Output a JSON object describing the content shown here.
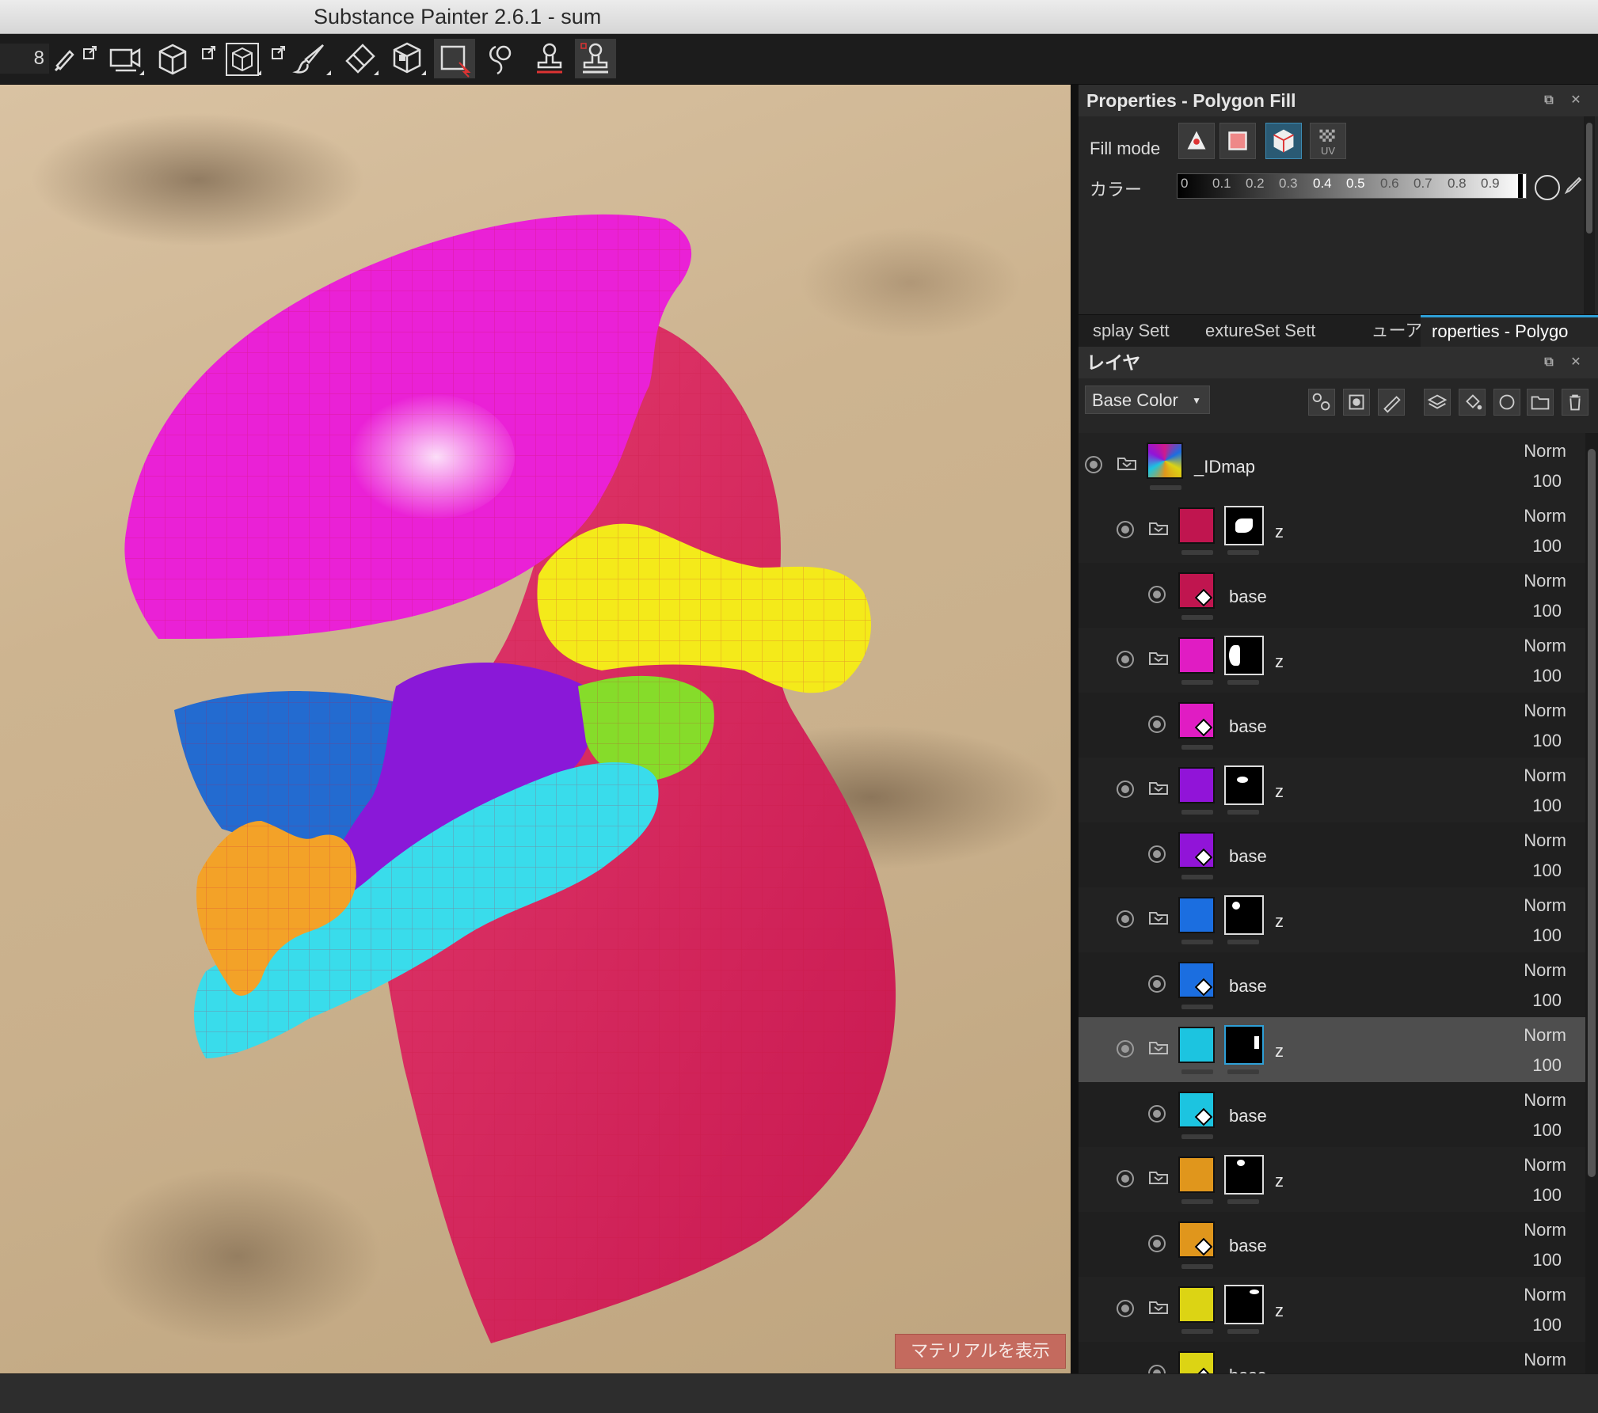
{
  "window": {
    "title": "Substance Painter 2.6.1 - sum"
  },
  "toolbar": {
    "brush_size": "8",
    "tools": [
      "brush-settings-icon",
      "camera-icon",
      "cube-icon",
      "cube-outline-icon",
      "paint-brush-icon",
      "eraser-icon",
      "projection-icon",
      "polygon-fill-icon",
      "smudge-icon",
      "clone-stamp-icon",
      "material-picker-icon"
    ]
  },
  "viewport": {
    "material_button": "マテリアルを表示"
  },
  "properties": {
    "title": "Properties - Polygon Fill",
    "fill_mode_label": "Fill mode",
    "fill_modes": [
      "triangle-fill-icon",
      "quad-fill-icon",
      "mesh-fill-icon",
      "uv-fill-icon"
    ],
    "fill_mode_selected": "mesh-fill-icon",
    "uv_label": "UV",
    "color_label": "カラー",
    "color_ticks": [
      "0",
      "0.1",
      "0.2",
      "0.3",
      "0.4",
      "0.5",
      "0.6",
      "0.7",
      "0.8",
      "0.9"
    ]
  },
  "tabs": [
    {
      "label": "splay Sett"
    },
    {
      "label": "extureSet Sett"
    },
    {
      "label": "ューア"
    },
    {
      "label": "roperties - Polygo",
      "active": true
    }
  ],
  "layers": {
    "title": "レイヤ",
    "channel": "Base Color",
    "rows": [
      {
        "kind": "group",
        "name": "_IDmap",
        "blend": "Norm",
        "opacity": "100",
        "depth": 0,
        "color": "#d01a8c",
        "mask": "none"
      },
      {
        "kind": "group",
        "name": "z",
        "blend": "Norm",
        "opacity": "100",
        "depth": 1,
        "color": "#c0154f",
        "mask": "shape-a"
      },
      {
        "kind": "fill",
        "name": "base",
        "blend": "Norm",
        "opacity": "100",
        "depth": 2,
        "color": "#c0154f"
      },
      {
        "kind": "group",
        "name": "z",
        "blend": "Norm",
        "opacity": "100",
        "depth": 1,
        "color": "#e01cc3",
        "mask": "shape-b"
      },
      {
        "kind": "fill",
        "name": "base",
        "blend": "Norm",
        "opacity": "100",
        "depth": 2,
        "color": "#e01cc3"
      },
      {
        "kind": "group",
        "name": "z",
        "blend": "Norm",
        "opacity": "100",
        "depth": 1,
        "color": "#9114d8",
        "mask": "shape-c"
      },
      {
        "kind": "fill",
        "name": "base",
        "blend": "Norm",
        "opacity": "100",
        "depth": 2,
        "color": "#9114d8"
      },
      {
        "kind": "group",
        "name": "z",
        "blend": "Norm",
        "opacity": "100",
        "depth": 1,
        "color": "#1b6ee0",
        "mask": "shape-d"
      },
      {
        "kind": "fill",
        "name": "base",
        "blend": "Norm",
        "opacity": "100",
        "depth": 2,
        "color": "#1b6ee0"
      },
      {
        "kind": "group",
        "name": "z",
        "blend": "Norm",
        "opacity": "100",
        "depth": 1,
        "color": "#1cc4e0",
        "mask": "shape-e",
        "selected": true
      },
      {
        "kind": "fill",
        "name": "base",
        "blend": "Norm",
        "opacity": "100",
        "depth": 2,
        "color": "#1cc4e0"
      },
      {
        "kind": "group",
        "name": "z",
        "blend": "Norm",
        "opacity": "100",
        "depth": 1,
        "color": "#e0961c",
        "mask": "shape-f"
      },
      {
        "kind": "fill",
        "name": "base",
        "blend": "Norm",
        "opacity": "100",
        "depth": 2,
        "color": "#e0961c"
      },
      {
        "kind": "group",
        "name": "z",
        "blend": "Norm",
        "opacity": "100",
        "depth": 1,
        "color": "#dcd414",
        "mask": "shape-g"
      },
      {
        "kind": "fill",
        "name": "base",
        "blend": "Norm",
        "opacity": "",
        "depth": 2,
        "color": "#dcd414"
      }
    ]
  },
  "colors": {
    "accent": "#2e9fd6",
    "panel": "#262626",
    "material_button": "#c46a5e"
  }
}
